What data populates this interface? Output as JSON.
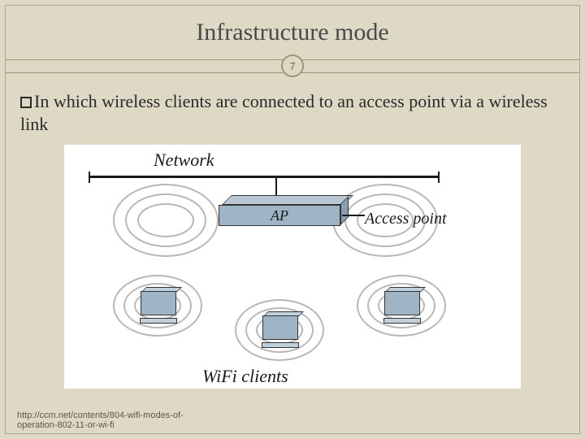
{
  "title": "Infrastructure mode",
  "page_number": "7",
  "bullet_text": "In which wireless clients are connected to an access point via a wireless link",
  "diagram": {
    "network_label": "Network",
    "ap_label": "AP",
    "access_point_label": "Access point",
    "clients_label": "WiFi clients"
  },
  "source_line1": "http://ccm.net/contents/804-wifi-modes-of-",
  "source_line2": "operation-802-11-or-wi-fi"
}
